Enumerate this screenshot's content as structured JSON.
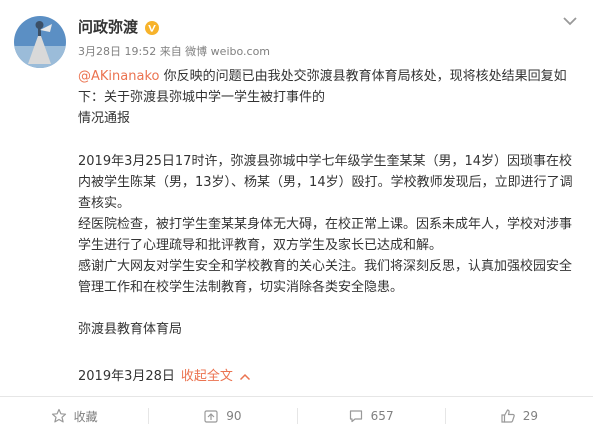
{
  "post": {
    "username": "问政弥渡",
    "meta": "3月28日 19:52 来自 微博 weibo.com",
    "mention": "@AKinanako",
    "intro": "你反映的问题已由我处交弥渡县教育体育局核处，现将核处结果回复如下：关于弥渡县弥城中学一学生被打事件的",
    "intro_tail": "情况通报",
    "para1": "2019年3月25日17时许，弥渡县弥城中学七年级学生奎某某（男，14岁）因琐事在校内被学生陈某（男，13岁）、杨某（男，14岁）殴打。学校教师发现后，立即进行了调查核实。",
    "para2": "经医院检查，被打学生奎某某身体无大碍，在校正常上课。因系未成年人，学校对涉事学生进行了心理疏导和批评教育，双方学生及家长已达成和解。",
    "para3": "感谢广大网友对学生安全和学校教育的关心关注。我们将深刻反思，认真加强校园安全管理工作和在校学生法制教育，切实消除各类安全隐患。",
    "signature": "弥渡县教育体育局",
    "date": "2019年3月28日",
    "collapse_label": "收起全文"
  },
  "actions": {
    "favorite_label": "收藏",
    "repost_count": "90",
    "comment_count": "657",
    "like_count": "29"
  },
  "colors": {
    "link": "#eb7350",
    "verified": "#f7b32b",
    "muted": "#808080"
  }
}
